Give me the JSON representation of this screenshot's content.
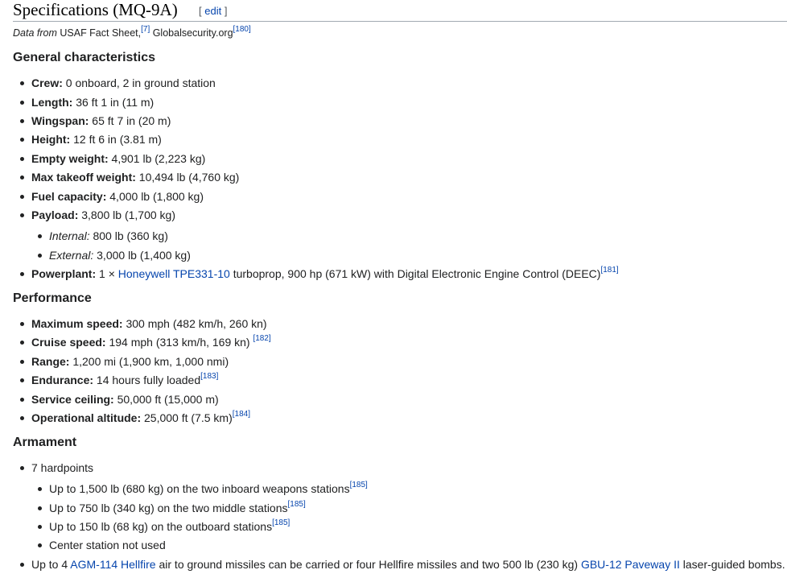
{
  "heading": {
    "title": "Specifications (MQ-9A)",
    "edit_open": "[ ",
    "edit_label": "edit",
    "edit_close": " ]"
  },
  "source": {
    "italic": "Data from",
    "text1": " USAF Fact Sheet,",
    "ref1": "[7]",
    "text2": " Globalsecurity.org",
    "ref2": "[180]"
  },
  "general": {
    "title": "General characteristics",
    "crew": {
      "label": "Crew:",
      "value": " 0 onboard, 2 in ground station"
    },
    "length": {
      "label": "Length:",
      "value": " 36 ft 1 in (11 m)"
    },
    "wingspan": {
      "label": "Wingspan:",
      "value": " 65 ft 7 in (20 m)"
    },
    "height": {
      "label": "Height:",
      "value": " 12 ft 6 in (3.81 m)"
    },
    "empty_weight": {
      "label": "Empty weight:",
      "value": " 4,901 lb (2,223 kg)"
    },
    "max_takeoff": {
      "label": "Max takeoff weight:",
      "value": " 10,494 lb (4,760 kg)"
    },
    "fuel": {
      "label": "Fuel capacity:",
      "value": " 4,000 lb (1,800 kg)"
    },
    "payload": {
      "label": "Payload:",
      "value": " 3,800 lb (1,700 kg)"
    },
    "internal": {
      "label": "Internal:",
      "value": " 800 lb (360 kg)"
    },
    "external": {
      "label": "External:",
      "value": " 3,000 lb (1,400 kg)"
    },
    "powerplant": {
      "label": "Powerplant:",
      "pre": " 1 × ",
      "link": "Honeywell TPE331-10",
      "post": " turboprop, 900 hp (671 kW) with Digital Electronic Engine Control (DEEC)",
      "ref": "[181]"
    }
  },
  "performance": {
    "title": "Performance",
    "max_speed": {
      "label": "Maximum speed:",
      "value": " 300 mph (482 km/h, 260 kn)"
    },
    "cruise": {
      "label": "Cruise speed:",
      "value": " 194 mph (313 km/h, 169 kn) ",
      "ref": "[182]"
    },
    "range": {
      "label": "Range:",
      "value": " 1,200 mi (1,900 km, 1,000 nmi)"
    },
    "endurance": {
      "label": "Endurance:",
      "value": " 14 hours fully loaded",
      "ref": "[183]"
    },
    "ceiling": {
      "label": "Service ceiling:",
      "value": " 50,000 ft (15,000 m)"
    },
    "altitude": {
      "label": "Operational altitude:",
      "value": " 25,000 ft (7.5 km)",
      "ref": "[184]"
    }
  },
  "armament": {
    "title": "Armament",
    "hardpoints": "7 hardpoints",
    "inboard": {
      "text": "Up to 1,500 lb (680 kg) on the two inboard weapons stations",
      "ref": "[185]"
    },
    "middle": {
      "text": "Up to 750 lb (340 kg) on the two middle stations",
      "ref": "[185]"
    },
    "outboard": {
      "text": "Up to 150 lb (68 kg) on the outboard stations",
      "ref": "[185]"
    },
    "center": "Center station not used",
    "missiles": {
      "pre": "Up to 4 ",
      "link1": "AGM-114 Hellfire",
      "mid": " air to ground missiles can be carried or four Hellfire missiles and two 500 lb (230 kg) ",
      "link2": "GBU-12 Paveway II",
      "post": " laser-guided bombs."
    }
  }
}
